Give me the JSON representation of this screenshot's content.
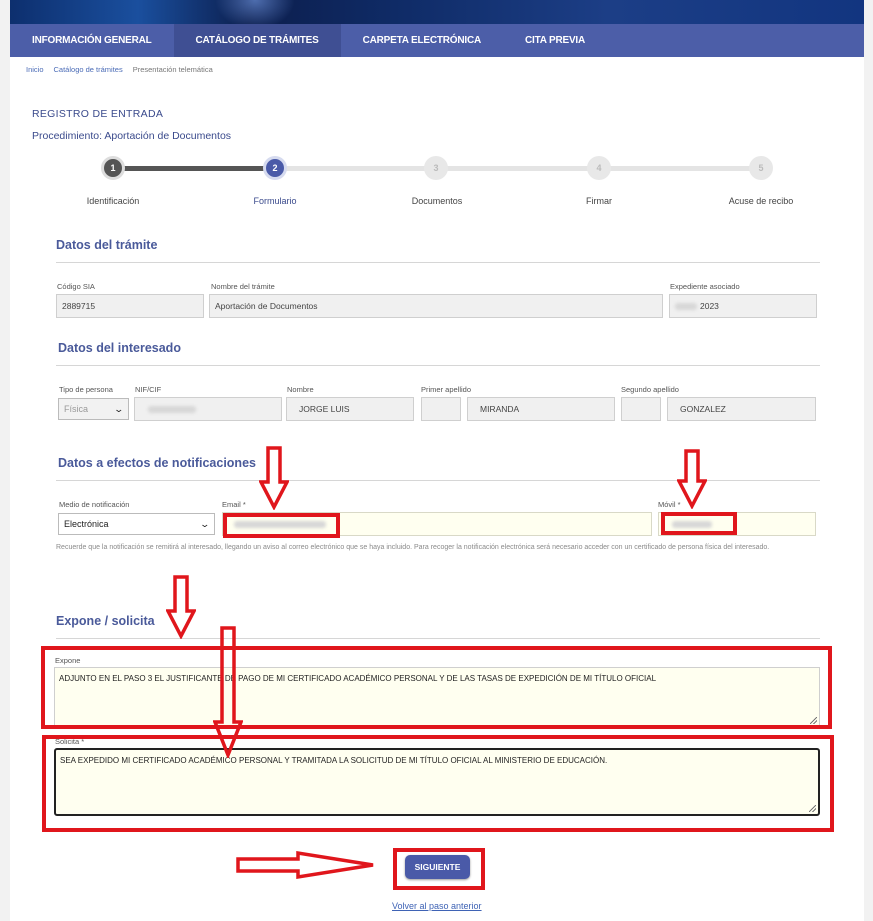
{
  "nav": {
    "items": [
      {
        "label": "INFORMACIÓN GENERAL"
      },
      {
        "label": "CATÁLOGO DE TRÁMITES"
      },
      {
        "label": "CARPETA ELECTRÓNICA"
      },
      {
        "label": "CITA PREVIA"
      }
    ],
    "active_index": 1
  },
  "breadcrumb": [
    "Inicio",
    "Catálogo de trámites",
    "Presentación telemática"
  ],
  "page": {
    "title": "REGISTRO DE ENTRADA",
    "procedure": "Procedimiento: Aportación de Documentos"
  },
  "steps": [
    {
      "number": "1",
      "label": "Identificación",
      "state": "done"
    },
    {
      "number": "2",
      "label": "Formulario",
      "state": "current"
    },
    {
      "number": "3",
      "label": "Documentos",
      "state": "pending"
    },
    {
      "number": "4",
      "label": "Firmar",
      "state": "pending"
    },
    {
      "number": "5",
      "label": "Acuse de recibo",
      "state": "pending"
    }
  ],
  "tramite": {
    "title": "Datos del trámite",
    "codigo_label": "Código SIA",
    "codigo_value": "2889715",
    "nombre_label": "Nombre del trámite",
    "nombre_value": "Aportación de Documentos",
    "expediente_label": "Expediente asociado",
    "expediente_value": "2023"
  },
  "interesado": {
    "title": "Datos del interesado",
    "tipo_label": "Tipo de persona",
    "tipo_value": "Física",
    "nif_label": "NIF/CIF",
    "nombre_label": "Nombre",
    "nombre_value": "JORGE LUIS",
    "apellido1_label": "Primer apellido",
    "apellido1_value": "MIRANDA",
    "apellido2_label": "Segundo apellido",
    "apellido2_value": "GONZALEZ"
  },
  "notificaciones": {
    "title": "Datos a efectos de notificaciones",
    "medio_label": "Medio de notificación",
    "medio_value": "Electrónica",
    "email_label": "Email *",
    "movil_label": "Móvil *",
    "note": "Recuerde que la notificación se remitirá al interesado, llegando un aviso al correo electrónico que se haya incluido. Para recoger la notificación electrónica será necesario acceder con un certificado de persona física del interesado."
  },
  "expone_solicita": {
    "title": "Expone / solicita",
    "expone_label": "Expone",
    "expone_value": "ADJUNTO EN EL PASO 3 EL JUSTIFICANTE DE PAGO DE MI CERTIFICADO ACADÉMICO PERSONAL Y DE LAS TASAS DE EXPEDICIÓN DE MI TÍTULO OFICIAL",
    "solicita_label": "Solicita *",
    "solicita_value": "SEA EXPEDIDO MI CERTIFICADO ACADÉMICO PERSONAL Y TRAMITADA LA SOLICITUD DE MI TÍTULO OFICIAL AL MINISTERIO DE EDUCACIÓN."
  },
  "actions": {
    "next_label": "SIGUIENTE",
    "back_label": "Volver al paso anterior"
  },
  "annotation_color": "#e0161c",
  "icons": {
    "select_caret": "chevron-down-icon",
    "resize": "resize-grip-icon",
    "annotation": "red-arrow-icon"
  }
}
